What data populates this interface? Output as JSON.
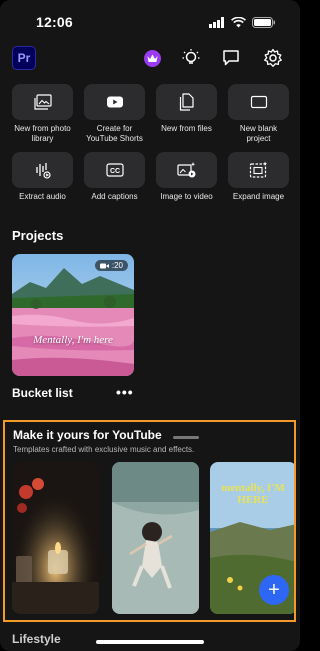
{
  "status_bar": {
    "time": "12:06"
  },
  "app": {
    "logo_text": "Pr"
  },
  "quick_actions": [
    {
      "label": "New from photo library",
      "icon": "photo-library-icon"
    },
    {
      "label": "Create for YouTube Shorts",
      "icon": "youtube-shorts-icon"
    },
    {
      "label": "New from files",
      "icon": "files-icon"
    },
    {
      "label": "New blank project",
      "icon": "blank-project-icon"
    },
    {
      "label": "Extract audio",
      "icon": "extract-audio-icon"
    },
    {
      "label": "Add captions",
      "icon": "captions-icon"
    },
    {
      "label": "Image to video",
      "icon": "image-to-video-icon"
    },
    {
      "label": "Expand image",
      "icon": "expand-image-icon"
    }
  ],
  "projects": {
    "title": "Projects",
    "items": [
      {
        "name": "Bucket list",
        "duration": ":20",
        "overlay_text": "Mentally, I'm here",
        "more": "•••"
      }
    ]
  },
  "promo": {
    "title": "Make it yours for YouTube",
    "subtitle": "Templates crafted with exclusive music and effects.",
    "template_text": "mentally, I'M HERE",
    "fab": "+"
  },
  "next_section": {
    "title": "Lifestyle"
  },
  "colors": {
    "background": "#151515",
    "tile": "#2c2c2e",
    "highlight_border": "#f39a2a",
    "fab": "#2f67f5",
    "premium_crown": "#9a3bf0"
  }
}
